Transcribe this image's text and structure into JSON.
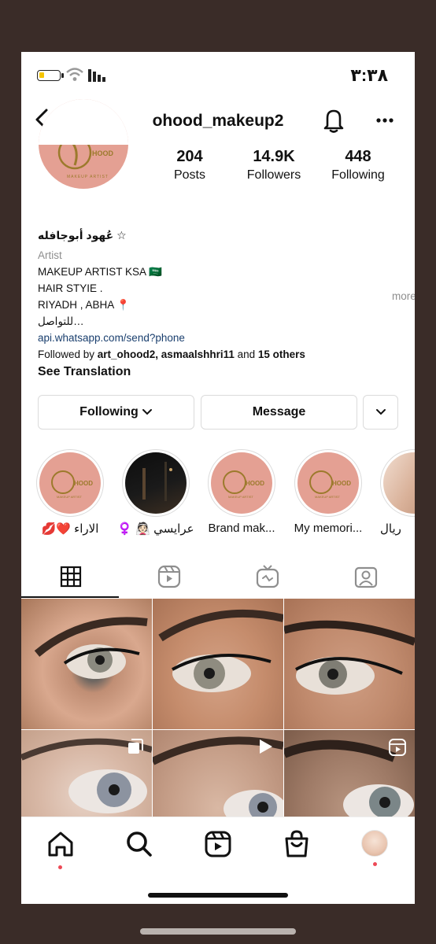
{
  "status_bar": {
    "time": "٣:٣٨"
  },
  "header": {
    "username": "ohood_makeup2"
  },
  "profile": {
    "stats": [
      {
        "value": "204",
        "label": "Posts"
      },
      {
        "value": "14.9K",
        "label": "Followers"
      },
      {
        "value": "448",
        "label": "Following"
      }
    ]
  },
  "bio": {
    "name": "عُهود أبوجافله ☆",
    "category": "Artist",
    "lines": [
      "MAKEUP ARTIST KSA 🇸🇦",
      "HAIR STYIE .",
      "RIYADH , ABHA 📍"
    ],
    "contact": "للتواصل…",
    "more": "more",
    "link": "api.whatsapp.com/send?phone",
    "followed_prefix": "Followed by ",
    "followed_users": "art_ohood2, asmaalshhri11",
    "followed_and": " and ",
    "followed_others": "15 others",
    "see_translation": "See Translation"
  },
  "actions": {
    "following": "Following",
    "message": "Message"
  },
  "highlights": [
    {
      "label": "💋❤️ الاراء"
    },
    {
      "label": "♀️ 👰🏻 عرايسي"
    },
    {
      "label": "Brand mak..."
    },
    {
      "label": "My memori..."
    },
    {
      "label": "ريال"
    }
  ],
  "tabs": [
    "grid",
    "reels",
    "igtv",
    "tagged"
  ],
  "grid_icons": [
    "multiple-icon",
    "video-icon",
    "reel-icon"
  ],
  "colors": {
    "avatar_bg": "#e4a093",
    "brand_gold": "#9c7a2c",
    "link": "#1a3f6e",
    "notification_dot": "#ed4956"
  }
}
